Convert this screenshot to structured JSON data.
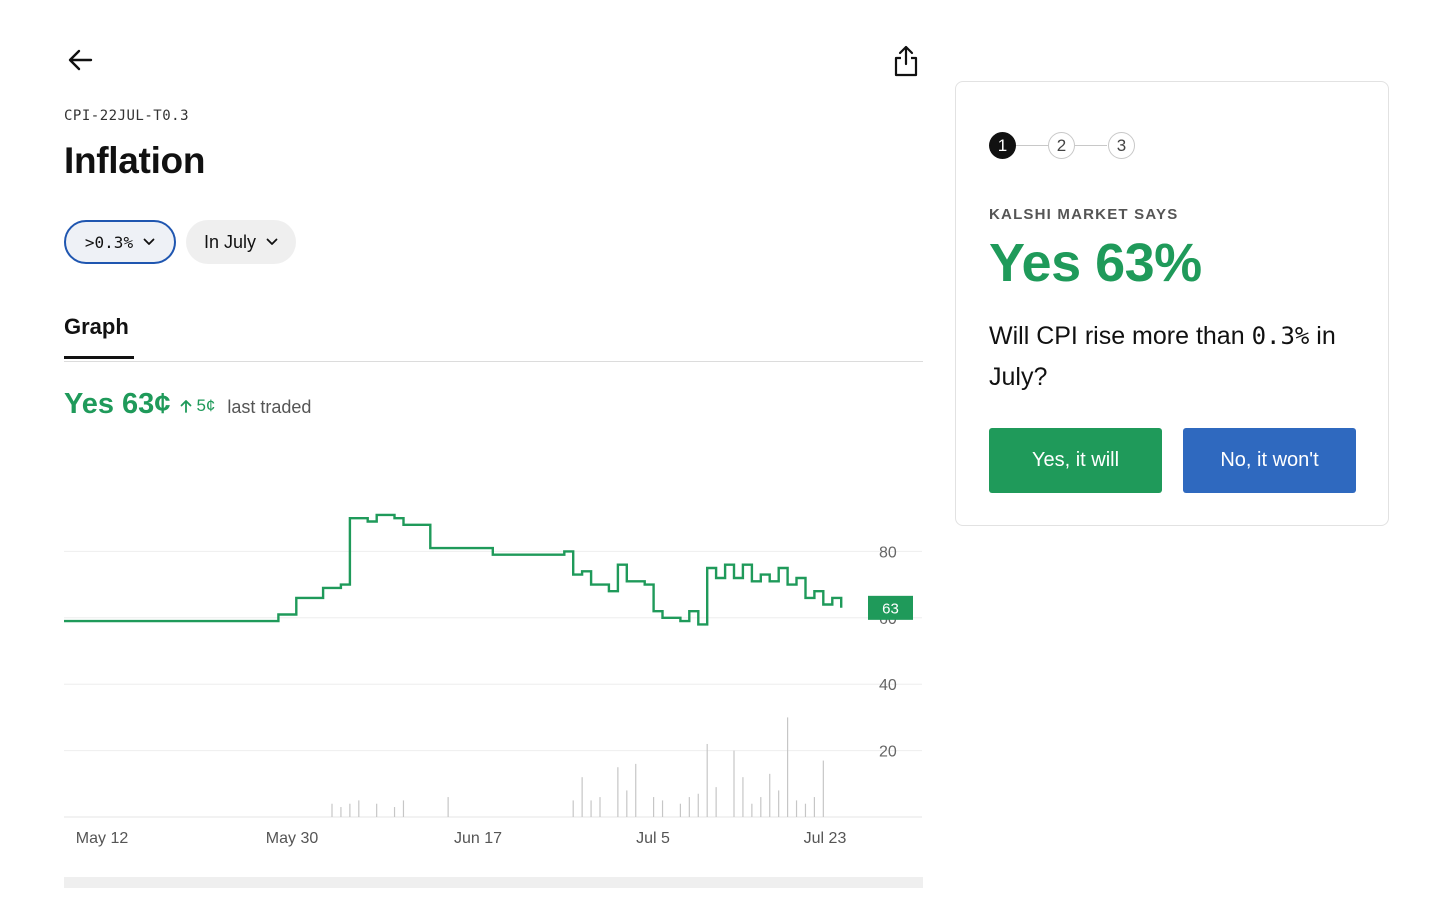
{
  "header": {
    "ticker": "CPI-22JUL-T0.3",
    "title": "Inflation"
  },
  "filters": {
    "strike": ">0.3%",
    "period": "In July"
  },
  "tabs": [
    {
      "label": "Graph",
      "active": true
    }
  ],
  "price": {
    "main": "Yes 63¢",
    "change": "5¢",
    "label": "last traded"
  },
  "chart_data": {
    "type": "line",
    "x_ticks": [
      "May 12",
      "May 30",
      "Jun 17",
      "Jul 5",
      "Jul 23"
    ],
    "y_ticks": [
      20,
      40,
      60,
      80
    ],
    "ylim": [
      0,
      100
    ],
    "grid": true,
    "last_value_label": "63",
    "line_color": "#1f9a5a",
    "volume_color": "#c6c6c6",
    "series": [
      {
        "values": [
          [
            0,
            59
          ],
          [
            24,
            59
          ],
          [
            24,
            61
          ],
          [
            26,
            61
          ],
          [
            26,
            66
          ],
          [
            29,
            66
          ],
          [
            29,
            69
          ],
          [
            31,
            69
          ],
          [
            31,
            70
          ],
          [
            32,
            70
          ],
          [
            32,
            90
          ],
          [
            34,
            90
          ],
          [
            34,
            89
          ],
          [
            35,
            89
          ],
          [
            35,
            91
          ],
          [
            37,
            91
          ],
          [
            37,
            90
          ],
          [
            38,
            90
          ],
          [
            38,
            88
          ],
          [
            41,
            88
          ],
          [
            41,
            81
          ],
          [
            48,
            81
          ],
          [
            48,
            79
          ],
          [
            56,
            79
          ],
          [
            56,
            80
          ],
          [
            57,
            80
          ],
          [
            57,
            73
          ],
          [
            58,
            73
          ],
          [
            58,
            74
          ],
          [
            59,
            74
          ],
          [
            59,
            70
          ],
          [
            61,
            70
          ],
          [
            61,
            68
          ],
          [
            62,
            68
          ],
          [
            62,
            76
          ],
          [
            63,
            76
          ],
          [
            63,
            71
          ],
          [
            65,
            71
          ],
          [
            65,
            70
          ],
          [
            66,
            70
          ],
          [
            66,
            62
          ],
          [
            67,
            62
          ],
          [
            67,
            60
          ],
          [
            69,
            60
          ],
          [
            69,
            59
          ],
          [
            70,
            59
          ],
          [
            70,
            62
          ],
          [
            71,
            62
          ],
          [
            71,
            58
          ],
          [
            72,
            58
          ],
          [
            72,
            75
          ],
          [
            73,
            75
          ],
          [
            73,
            72
          ],
          [
            74,
            72
          ],
          [
            74,
            76
          ],
          [
            75,
            76
          ],
          [
            75,
            72
          ],
          [
            76,
            72
          ],
          [
            76,
            76
          ],
          [
            77,
            76
          ],
          [
            77,
            71
          ],
          [
            78,
            71
          ],
          [
            78,
            73
          ],
          [
            79,
            73
          ],
          [
            79,
            71
          ],
          [
            80,
            71
          ],
          [
            80,
            75
          ],
          [
            81,
            75
          ],
          [
            81,
            70
          ],
          [
            82,
            70
          ],
          [
            82,
            72
          ],
          [
            83,
            72
          ],
          [
            83,
            66
          ],
          [
            84,
            66
          ],
          [
            84,
            68
          ],
          [
            85,
            68
          ],
          [
            85,
            64
          ],
          [
            86,
            64
          ],
          [
            86,
            66
          ],
          [
            87,
            66
          ],
          [
            87,
            63
          ]
        ]
      }
    ],
    "volume": [
      [
        30,
        4
      ],
      [
        31,
        3
      ],
      [
        32,
        4
      ],
      [
        33,
        5
      ],
      [
        35,
        4
      ],
      [
        37,
        3
      ],
      [
        38,
        5
      ],
      [
        43,
        6
      ],
      [
        57,
        5
      ],
      [
        58,
        12
      ],
      [
        59,
        5
      ],
      [
        60,
        6
      ],
      [
        62,
        15
      ],
      [
        63,
        8
      ],
      [
        64,
        16
      ],
      [
        66,
        6
      ],
      [
        67,
        5
      ],
      [
        69,
        4
      ],
      [
        70,
        6
      ],
      [
        71,
        7
      ],
      [
        72,
        22
      ],
      [
        73,
        9
      ],
      [
        75,
        20
      ],
      [
        76,
        12
      ],
      [
        77,
        4
      ],
      [
        78,
        6
      ],
      [
        79,
        13
      ],
      [
        80,
        8
      ],
      [
        81,
        30
      ],
      [
        82,
        5
      ],
      [
        83,
        4
      ],
      [
        84,
        6
      ],
      [
        85,
        17
      ]
    ]
  },
  "card": {
    "steps": [
      "1",
      "2",
      "3"
    ],
    "market_label": "KALSHI MARKET SAYS",
    "market_value": "Yes 63%",
    "question_before": "Will CPI rise more than ",
    "question_mono": "0.3%",
    "question_after": " in July?",
    "yes_label": "Yes, it will",
    "no_label": "No, it won't"
  }
}
